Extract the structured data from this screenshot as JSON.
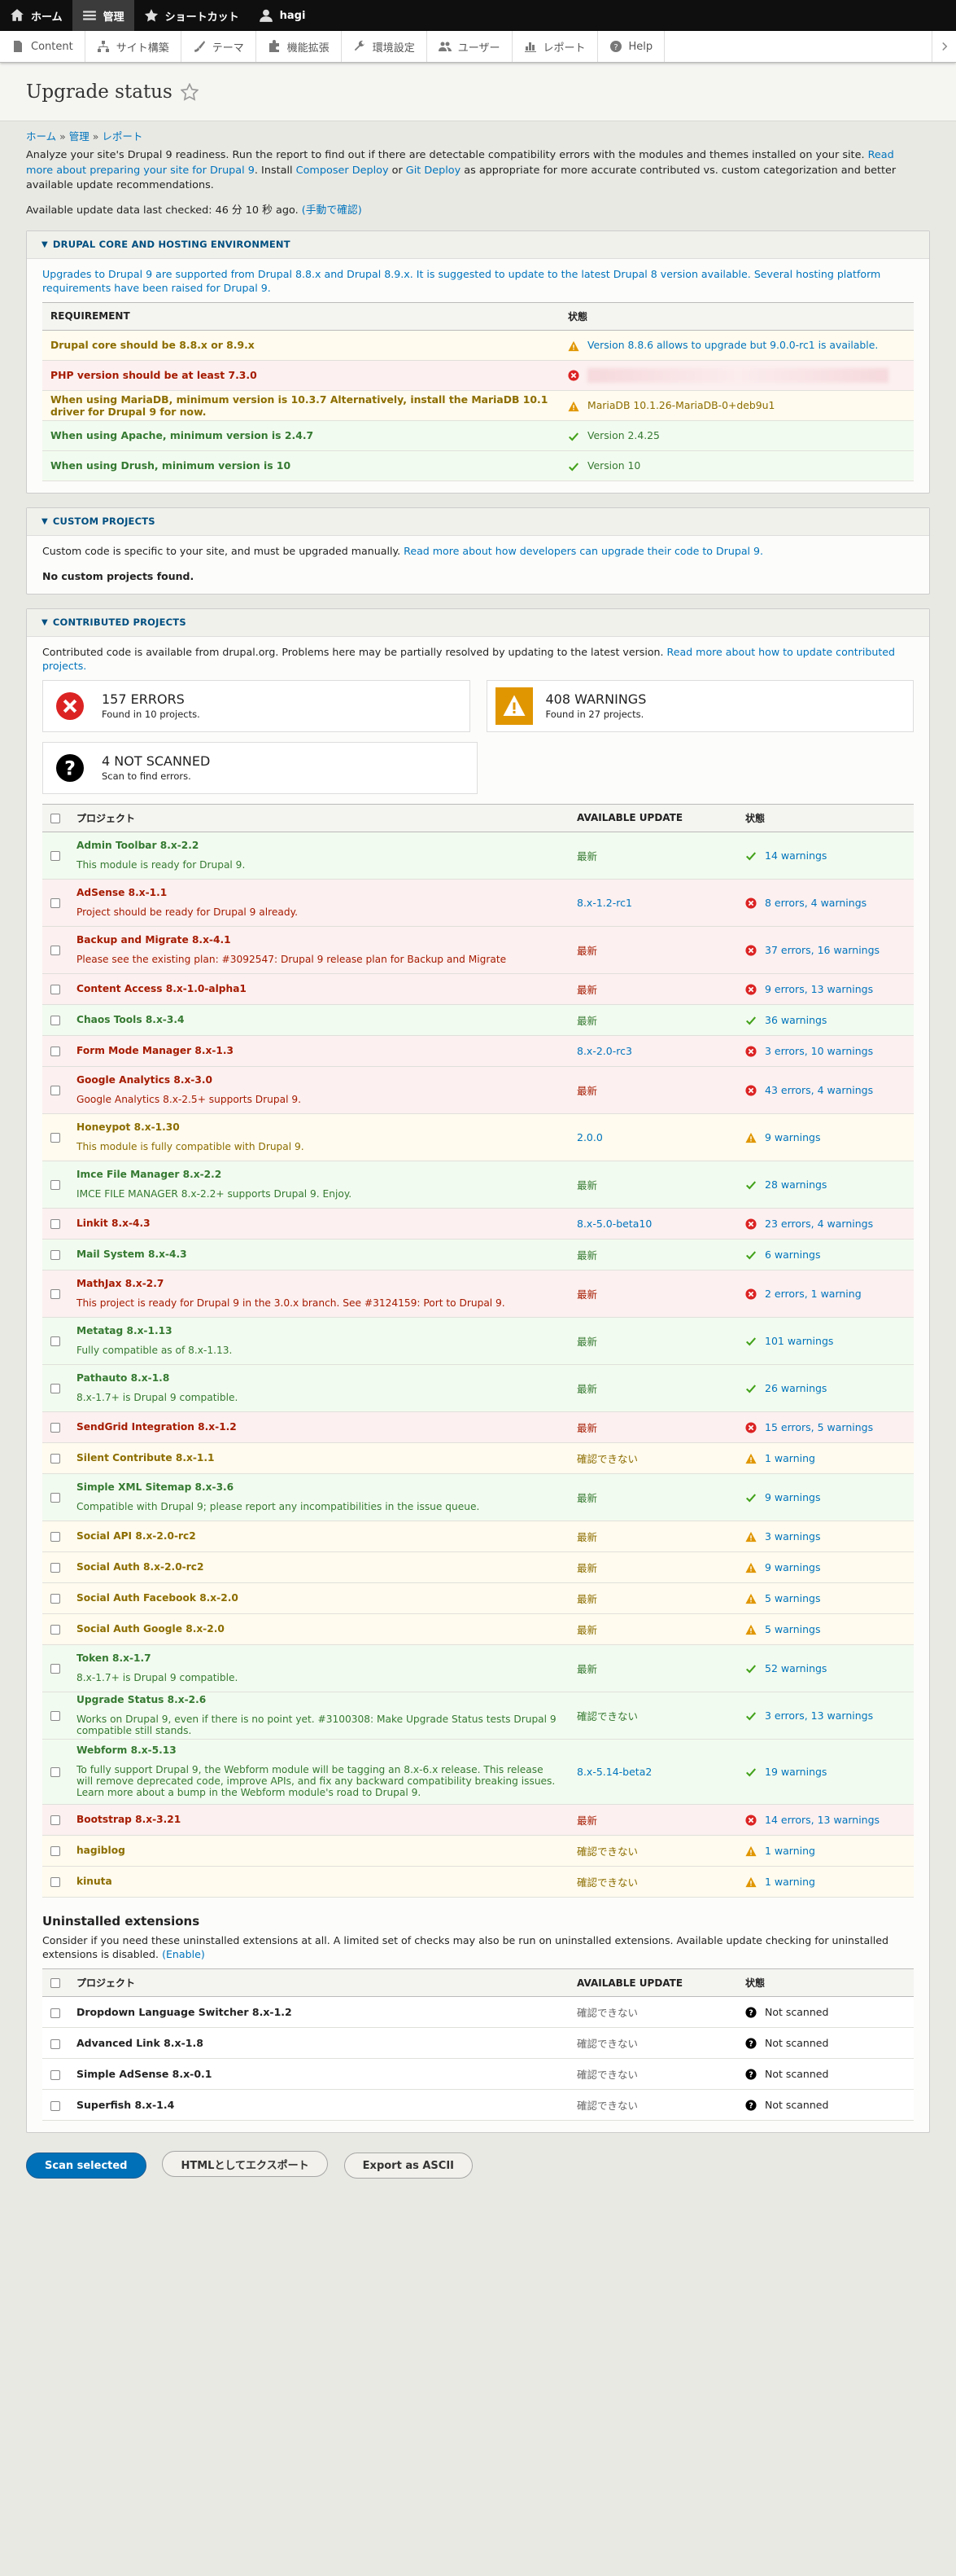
{
  "toolbar": {
    "home": "ホーム",
    "manage": "管理",
    "shortcuts": "ショートカット",
    "user": "hagi"
  },
  "tray": {
    "content": "Content",
    "structure": "サイト構築",
    "appearance": "テーマ",
    "extend": "機能拡張",
    "config": "環境設定",
    "people": "ユーザー",
    "reports": "レポート",
    "help": "Help"
  },
  "page": {
    "title": "Upgrade status"
  },
  "breadcrumb": {
    "home": "ホーム",
    "manage": "管理",
    "reports": "レポート",
    "sep": "»"
  },
  "intro": {
    "text1": "Analyze your site's Drupal 9 readiness. Run the report to find out if there are detectable compatibility errors with the modules and themes installed on your site.",
    "link1": "Read more about preparing your site for Drupal 9",
    "text2": ". Install",
    "link2": "Composer Deploy",
    "text3": "or",
    "link3": "Git Deploy",
    "text4": "as appropriate for more accurate contributed vs. custom categorization and better available update recommendations."
  },
  "last_checked": {
    "text": "Available update data last checked: 46 分 10 秒 ago.",
    "link": "(手動で確認)"
  },
  "env": {
    "title": "Drupal core and hosting environment",
    "desc_a": "Upgrades to Drupal 9 are supported from Drupal 8.8.x and Drupal 8.9.x. It is suggested to update to the latest Drupal 8 version available.",
    "desc_b": "Several hosting platform requirements have been raised for Drupal 9.",
    "col_req": "REQUIREMENT",
    "col_status": "状態",
    "rows": [
      {
        "req": "Drupal core should be 8.8.x or 8.9.x",
        "status": "Version 8.8.6 allows to upgrade but 9.0.0-rc1 is available.",
        "state": "warning",
        "status_link": true
      },
      {
        "req": "PHP version should be at least 7.3.0",
        "status": "",
        "state": "error"
      },
      {
        "req": "When using MariaDB, minimum version is 10.3.7 Alternatively, install the MariaDB 10.1 driver for Drupal 9 for now.",
        "status": "MariaDB 10.1.26-MariaDB-0+deb9u1",
        "state": "warning"
      },
      {
        "req": "When using Apache, minimum version is 2.4.7",
        "status": "Version 2.4.25",
        "state": "ok"
      },
      {
        "req": "When using Drush, minimum version is 10",
        "status": "Version 10",
        "state": "ok"
      }
    ]
  },
  "custom": {
    "title": "Custom projects",
    "desc_text": "Custom code is specific to your site, and must be upgraded manually.",
    "desc_link": "Read more about how developers can upgrade their code to Drupal 9.",
    "none": "No custom projects found."
  },
  "contrib": {
    "title": "Contributed projects",
    "desc_text": "Contributed code is available from drupal.org. Problems here may be partially resolved by updating to the latest version.",
    "desc_link": "Read more about how to update contributed projects.",
    "errors": {
      "big": "157 ERRORS",
      "small": "Found in 10 projects."
    },
    "warnings": {
      "big": "408 WARNINGS",
      "small": "Found in 27 projects."
    },
    "notscanned": {
      "big": "4 NOT SCANNED",
      "small": "Scan to find errors."
    },
    "col_project": "プロジェクト",
    "col_update": "AVAILABLE UPDATE",
    "col_status": "状態",
    "rows": [
      {
        "name": "Admin Toolbar 8.x-2.2",
        "desc": "This module is ready for Drupal 9.",
        "update": "最新",
        "status": "14 warnings",
        "state": "ok"
      },
      {
        "name": "AdSense 8.x-1.1",
        "desc": "Project should be ready for Drupal 9 already.",
        "update": "8.x-1.2-rc1",
        "status": "8 errors, 4 warnings",
        "state": "error",
        "ulink": true
      },
      {
        "name": "Backup and Migrate 8.x-4.1",
        "desc": "Please see the existing plan: #3092547: Drupal 9 release plan for Backup and Migrate",
        "update": "最新",
        "status": "37 errors, 16 warnings",
        "state": "error"
      },
      {
        "name": "Content Access 8.x-1.0-alpha1",
        "desc": "",
        "update": "最新",
        "status": "9 errors, 13 warnings",
        "state": "error"
      },
      {
        "name": "Chaos Tools 8.x-3.4",
        "desc": "",
        "update": "最新",
        "status": "36 warnings",
        "state": "ok"
      },
      {
        "name": "Form Mode Manager 8.x-1.3",
        "desc": "",
        "update": "8.x-2.0-rc3",
        "status": "3 errors, 10 warnings",
        "state": "error",
        "ulink": true
      },
      {
        "name": "Google Analytics 8.x-3.0",
        "desc": "Google Analytics 8.x-2.5+ supports Drupal 9.",
        "update": "最新",
        "status": "43 errors, 4 warnings",
        "state": "error"
      },
      {
        "name": "Honeypot 8.x-1.30",
        "desc": "This module is fully compatible with Drupal 9.",
        "update": "2.0.0",
        "status": "9 warnings",
        "state": "warning",
        "ulink": true
      },
      {
        "name": "Imce File Manager 8.x-2.2",
        "desc": "IMCE FILE MANAGER 8.x-2.2+ supports Drupal 9. Enjoy.",
        "update": "最新",
        "status": "28 warnings",
        "state": "ok"
      },
      {
        "name": "Linkit 8.x-4.3",
        "desc": "",
        "update": "8.x-5.0-beta10",
        "status": "23 errors, 4 warnings",
        "state": "error",
        "ulink": true
      },
      {
        "name": "Mail System 8.x-4.3",
        "desc": "",
        "update": "最新",
        "status": "6 warnings",
        "state": "ok"
      },
      {
        "name": "MathJax 8.x-2.7",
        "desc": "This project is ready for Drupal 9 in the 3.0.x branch. See #3124159: Port to Drupal 9.",
        "update": "最新",
        "status": "2 errors, 1 warning",
        "state": "error"
      },
      {
        "name": "Metatag 8.x-1.13",
        "desc": "Fully compatible as of 8.x-1.13.",
        "update": "最新",
        "status": "101 warnings",
        "state": "ok"
      },
      {
        "name": "Pathauto 8.x-1.8",
        "desc": "8.x-1.7+ is Drupal 9 compatible.",
        "update": "最新",
        "status": "26 warnings",
        "state": "ok"
      },
      {
        "name": "SendGrid Integration 8.x-1.2",
        "desc": "",
        "update": "最新",
        "status": "15 errors, 5 warnings",
        "state": "error"
      },
      {
        "name": "Silent Contribute 8.x-1.1",
        "desc": "",
        "update": "確認できない",
        "status": "1 warning",
        "state": "warning"
      },
      {
        "name": "Simple XML Sitemap 8.x-3.6",
        "desc": "Compatible with Drupal 9; please report any incompatibilities in the issue queue.",
        "update": "最新",
        "status": "9 warnings",
        "state": "ok"
      },
      {
        "name": "Social API 8.x-2.0-rc2",
        "desc": "",
        "update": "最新",
        "status": "3 warnings",
        "state": "warning"
      },
      {
        "name": "Social Auth 8.x-2.0-rc2",
        "desc": "",
        "update": "最新",
        "status": "9 warnings",
        "state": "warning"
      },
      {
        "name": "Social Auth Facebook 8.x-2.0",
        "desc": "",
        "update": "最新",
        "status": "5 warnings",
        "state": "warning"
      },
      {
        "name": "Social Auth Google 8.x-2.0",
        "desc": "",
        "update": "最新",
        "status": "5 warnings",
        "state": "warning"
      },
      {
        "name": "Token 8.x-1.7",
        "desc": "8.x-1.7+ is Drupal 9 compatible.",
        "update": "最新",
        "status": "52 warnings",
        "state": "ok"
      },
      {
        "name": "Upgrade Status 8.x-2.6",
        "desc": "Works on Drupal 9, even if there is no point yet. #3100308: Make Upgrade Status tests Drupal 9 compatible still stands.",
        "update": "確認できない",
        "status": "3 errors, 13 warnings",
        "state": "ok"
      },
      {
        "name": "Webform 8.x-5.13",
        "desc": "To fully support Drupal 9, the Webform module will be tagging an 8.x-6.x release. This release will remove deprecated code, improve APIs, and fix any backward compatibility breaking issues. Learn more about a bump in the Webform module's road to Drupal 9.",
        "update": "8.x-5.14-beta2",
        "status": "19 warnings",
        "state": "ok",
        "ulink": true
      },
      {
        "name": "Bootstrap 8.x-3.21",
        "desc": "",
        "update": "最新",
        "status": "14 errors, 13 warnings",
        "state": "error"
      },
      {
        "name": "hagiblog",
        "desc": "",
        "update": "確認できない",
        "status": "1 warning",
        "state": "warning"
      },
      {
        "name": "kinuta",
        "desc": "",
        "update": "確認できない",
        "status": "1 warning",
        "state": "warning"
      }
    ]
  },
  "uninstalled": {
    "title": "Uninstalled extensions",
    "desc": "Consider if you need these uninstalled extensions at all. A limited set of checks may also be run on uninstalled extensions. Available update checking for uninstalled extensions is disabled.",
    "desc_link": "(Enable)",
    "col_project": "プロジェクト",
    "col_update": "AVAILABLE UPDATE",
    "col_status": "状態",
    "rows": [
      {
        "name": "Dropdown Language Switcher 8.x-1.2",
        "update": "確認できない",
        "status": "Not scanned"
      },
      {
        "name": "Advanced Link 8.x-1.8",
        "update": "確認できない",
        "status": "Not scanned"
      },
      {
        "name": "Simple AdSense 8.x-0.1",
        "update": "確認できない",
        "status": "Not scanned"
      },
      {
        "name": "Superfish 8.x-1.4",
        "update": "確認できない",
        "status": "Not scanned"
      }
    ]
  },
  "actions": {
    "scan": "Scan selected",
    "export_html": "HTMLとしてエクスポート",
    "export_ascii": "Export as ASCII"
  },
  "colors": {
    "error": "#a51b00",
    "warning": "#8c6d00",
    "ok": "#357a32",
    "link": "#0074bd",
    "primary": "#0071b8"
  }
}
